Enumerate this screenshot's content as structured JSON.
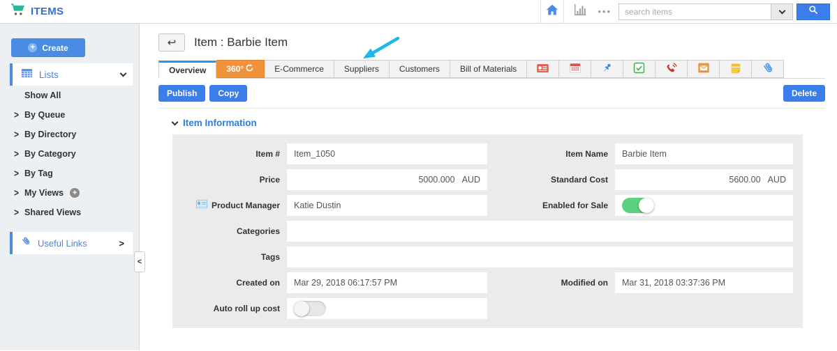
{
  "header": {
    "app_title": "ITEMS",
    "search": {
      "placeholder": "search items",
      "value": ""
    },
    "more_dots": "•••"
  },
  "sidebar": {
    "create_label": "Create",
    "lists_label": "Lists",
    "items": [
      {
        "label": "Show All"
      },
      {
        "label": "By Queue"
      },
      {
        "label": "By Directory"
      },
      {
        "label": "By Category"
      },
      {
        "label": "By Tag"
      },
      {
        "label": "My Views"
      },
      {
        "label": "Shared Views"
      }
    ],
    "useful_links_label": "Useful Links",
    "collapse_glyph": "<"
  },
  "main": {
    "back_glyph": "↩",
    "title": "Item : Barbie Item",
    "tabs": [
      "Overview",
      "360°",
      "E-Commerce",
      "Suppliers",
      "Customers",
      "Bill of Materials"
    ],
    "icon_tabs": [
      "idcard-icon",
      "calendar-icon",
      "pushpin-icon",
      "task-check-icon",
      "phone-icon",
      "mail-icon",
      "sticky-note-icon",
      "attachment-icon"
    ],
    "actions": {
      "publish": "Publish",
      "copy": "Copy",
      "delete": "Delete"
    },
    "section_title": "Item Information",
    "fields": {
      "item_number": {
        "label": "Item #",
        "value": "Item_1050"
      },
      "item_name": {
        "label": "Item Name",
        "value": "Barbie Item"
      },
      "price": {
        "label": "Price",
        "value": "5000.000",
        "currency": "AUD"
      },
      "standard_cost": {
        "label": "Standard Cost",
        "value": "5600.00",
        "currency": "AUD"
      },
      "product_manager": {
        "label": "Product Manager",
        "value": "Katie Dustin"
      },
      "enabled_for_sale": {
        "label": "Enabled for Sale",
        "state": "on"
      },
      "categories": {
        "label": "Categories",
        "value": ""
      },
      "tags": {
        "label": "Tags",
        "value": ""
      },
      "created_on": {
        "label": "Created on",
        "value": "Mar 29, 2018 06:17:57 PM"
      },
      "modified_on": {
        "label": "Modified on",
        "value": "Mar 31, 2018 03:37:36 PM"
      },
      "auto_roll_up_cost": {
        "label": "Auto roll up cost",
        "state": "off"
      }
    }
  },
  "colors": {
    "brand_teal": "#2bb79b",
    "title_blue": "#3b6bd6",
    "accent_blue": "#3b7de9",
    "active_tab_blue": "#2196f3",
    "tab_orange": "#f0913c",
    "toggle_green": "#5bd27d",
    "annotation_cyan": "#1db8ea",
    "panel_gray": "#ebebeb",
    "sidebar_gray": "#edf0f2"
  }
}
